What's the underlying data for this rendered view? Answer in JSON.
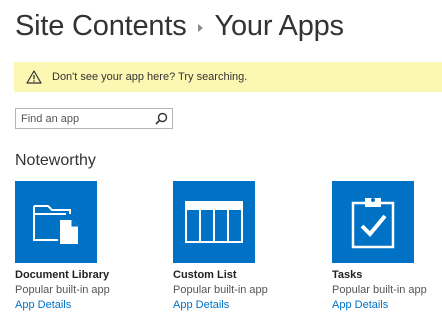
{
  "header": {
    "crumb_parent": "Site Contents",
    "crumb_current": "Your Apps"
  },
  "notice": {
    "icon": "warning-icon",
    "text": "Don't see your app here? Try searching."
  },
  "search": {
    "placeholder": "Find an app",
    "value": "",
    "icon": "search-icon"
  },
  "section": {
    "title": "Noteworthy"
  },
  "apps": [
    {
      "name": "Document Library",
      "description": "Popular built-in app",
      "link": "App Details",
      "icon": "document-library-icon"
    },
    {
      "name": "Custom List",
      "description": "Popular built-in app",
      "link": "App Details",
      "icon": "custom-list-icon"
    },
    {
      "name": "Tasks",
      "description": "Popular built-in app",
      "link": "App Details",
      "icon": "tasks-icon"
    }
  ],
  "colors": {
    "tile_background": "#0072c6",
    "link": "#0072c6",
    "notice_background": "#fcf8b3"
  }
}
